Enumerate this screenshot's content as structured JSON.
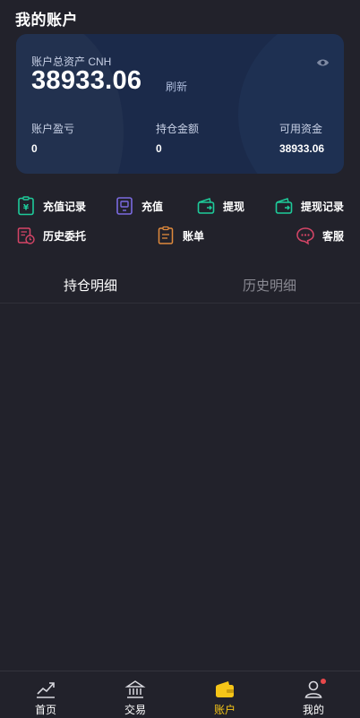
{
  "page": {
    "title": "我的账户"
  },
  "card": {
    "total_label": "账户总资产 CNH",
    "total_value": "38933.06",
    "refresh_label": "刷新",
    "stats": [
      {
        "label": "账户盈亏",
        "value": "0"
      },
      {
        "label": "持仓金额",
        "value": "0"
      },
      {
        "label": "可用资金",
        "value": "38933.06"
      }
    ]
  },
  "actions": [
    {
      "label": "充值记录",
      "icon": "recharge-record-icon",
      "color": "#1ecb9a"
    },
    {
      "label": "充值",
      "icon": "recharge-icon",
      "color": "#7b6ae0"
    },
    {
      "label": "提现",
      "icon": "wallet-withdraw-icon",
      "color": "#1ecb9a"
    },
    {
      "label": "提现记录",
      "icon": "withdraw-record-icon",
      "color": "#1ecb9a"
    },
    {
      "label": "历史委托",
      "icon": "history-order-icon",
      "color": "#d64567"
    },
    {
      "label": "账单",
      "icon": "bill-icon",
      "color": "#e08a3c"
    },
    {
      "label": "客服",
      "icon": "customer-service-icon",
      "color": "#d64567"
    }
  ],
  "tabs": [
    {
      "label": "持仓明细",
      "active": true
    },
    {
      "label": "历史明细",
      "active": false
    }
  ],
  "nav": [
    {
      "label": "首页",
      "icon": "chart-trend-icon",
      "active": false
    },
    {
      "label": "交易",
      "icon": "bank-icon",
      "active": false
    },
    {
      "label": "账户",
      "icon": "wallet-icon",
      "active": true
    },
    {
      "label": "我的",
      "icon": "user-icon",
      "active": false
    }
  ],
  "colors": {
    "background": "#22222b",
    "card": "#1b2a4a",
    "accent": "#f5c518",
    "badge": "#e8484b"
  }
}
